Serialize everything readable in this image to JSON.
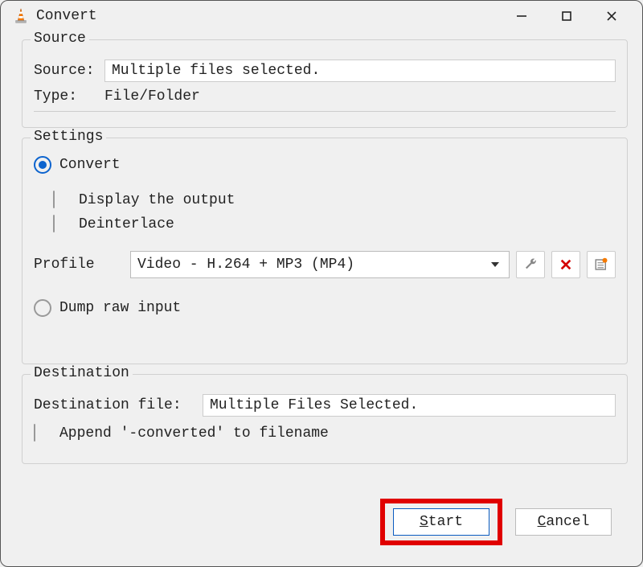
{
  "window": {
    "title": "Convert"
  },
  "source": {
    "legend": "Source",
    "source_label": "Source:",
    "source_value": "Multiple files selected.",
    "type_label": "Type:",
    "type_value": "File/Folder"
  },
  "settings": {
    "legend": "Settings",
    "convert_label": "Convert",
    "display_output_label": "Display the output",
    "deinterlace_label": "Deinterlace",
    "profile_label": "Profile",
    "profile_value": "Video - H.264 + MP3 (MP4)",
    "dump_raw_label": "Dump raw input"
  },
  "destination": {
    "legend": "Destination",
    "dest_file_label": "Destination file:",
    "dest_file_value": "Multiple Files Selected.",
    "append_label": "Append '-converted' to filename"
  },
  "buttons": {
    "start_u": "S",
    "start_rest": "tart",
    "cancel_u": "C",
    "cancel_rest": "ancel"
  },
  "icons": {
    "wrench": "wrench-icon",
    "delete": "delete-icon",
    "new_profile": "new-profile-icon"
  }
}
